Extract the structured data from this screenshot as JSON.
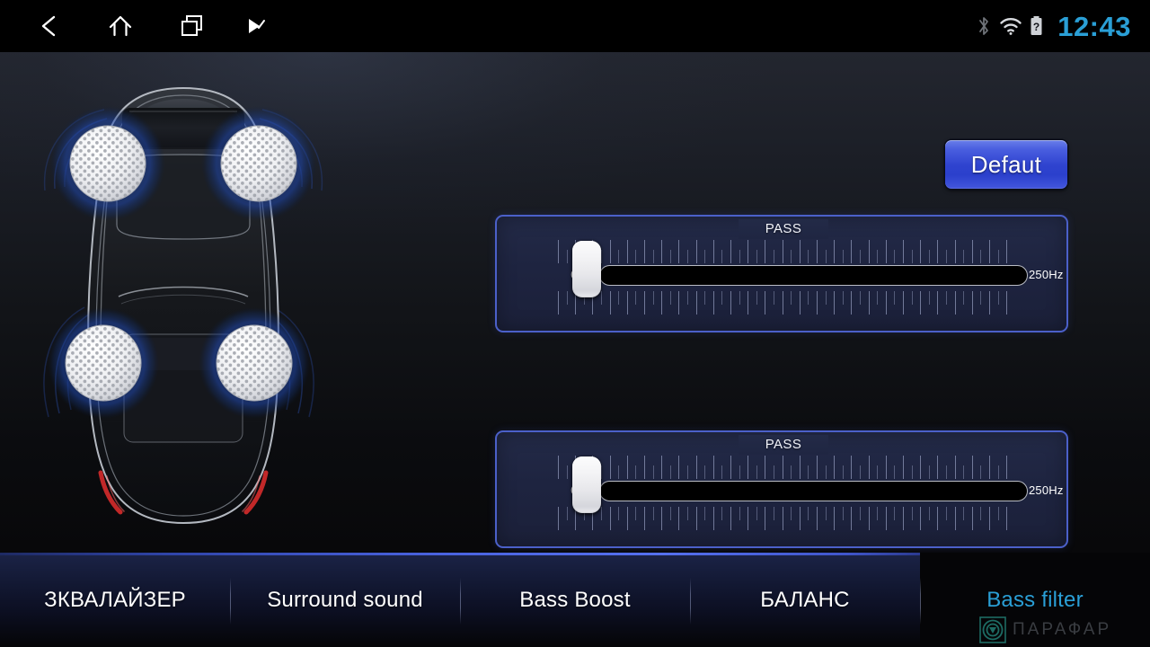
{
  "statusbar": {
    "nav": [
      {
        "name": "back-icon",
        "label": "Back"
      },
      {
        "name": "home-icon",
        "label": "Home"
      },
      {
        "name": "recents-icon",
        "label": "Recent apps"
      },
      {
        "name": "menu-icon",
        "label": "Menu"
      }
    ],
    "icons": [
      {
        "name": "bluetooth-icon",
        "label": "Bluetooth"
      },
      {
        "name": "wifi-icon",
        "label": "Wi-Fi"
      },
      {
        "name": "battery-unknown-icon",
        "label": "Battery unknown"
      }
    ],
    "clock": "12:43",
    "clock_color": "#2a9fd6"
  },
  "header": {
    "default_button_label": "Defaut",
    "default_button_color": "#3347d2"
  },
  "sliders": [
    {
      "id": "highpass",
      "title": "PASS",
      "min_label": "0Hz",
      "max_label": "250Hz",
      "value": 0,
      "min": 0,
      "max": 250,
      "unit": "Hz"
    },
    {
      "id": "lowpass",
      "title": "PASS",
      "min_label": "0Hz",
      "max_label": "250Hz",
      "value": 0,
      "min": 0,
      "max": 250,
      "unit": "Hz"
    }
  ],
  "tabs": [
    {
      "label": "ЗКВАЛАЙЗЕР",
      "active": false
    },
    {
      "label": "Surround sound",
      "active": false
    },
    {
      "label": "Bass Boost",
      "active": false
    },
    {
      "label": "БАЛАНС",
      "active": false
    },
    {
      "label": "Bass filter",
      "active": true
    }
  ],
  "tab_active_color": "#2a9fd6",
  "watermark": {
    "text": "ПАРАФАР",
    "logo_icon": "target-logo-icon",
    "logo_color": "#1d6b63"
  },
  "illustration": {
    "name": "car-top-view-with-speakers",
    "speakers": 4,
    "accent_color": "#1b3f8f"
  }
}
